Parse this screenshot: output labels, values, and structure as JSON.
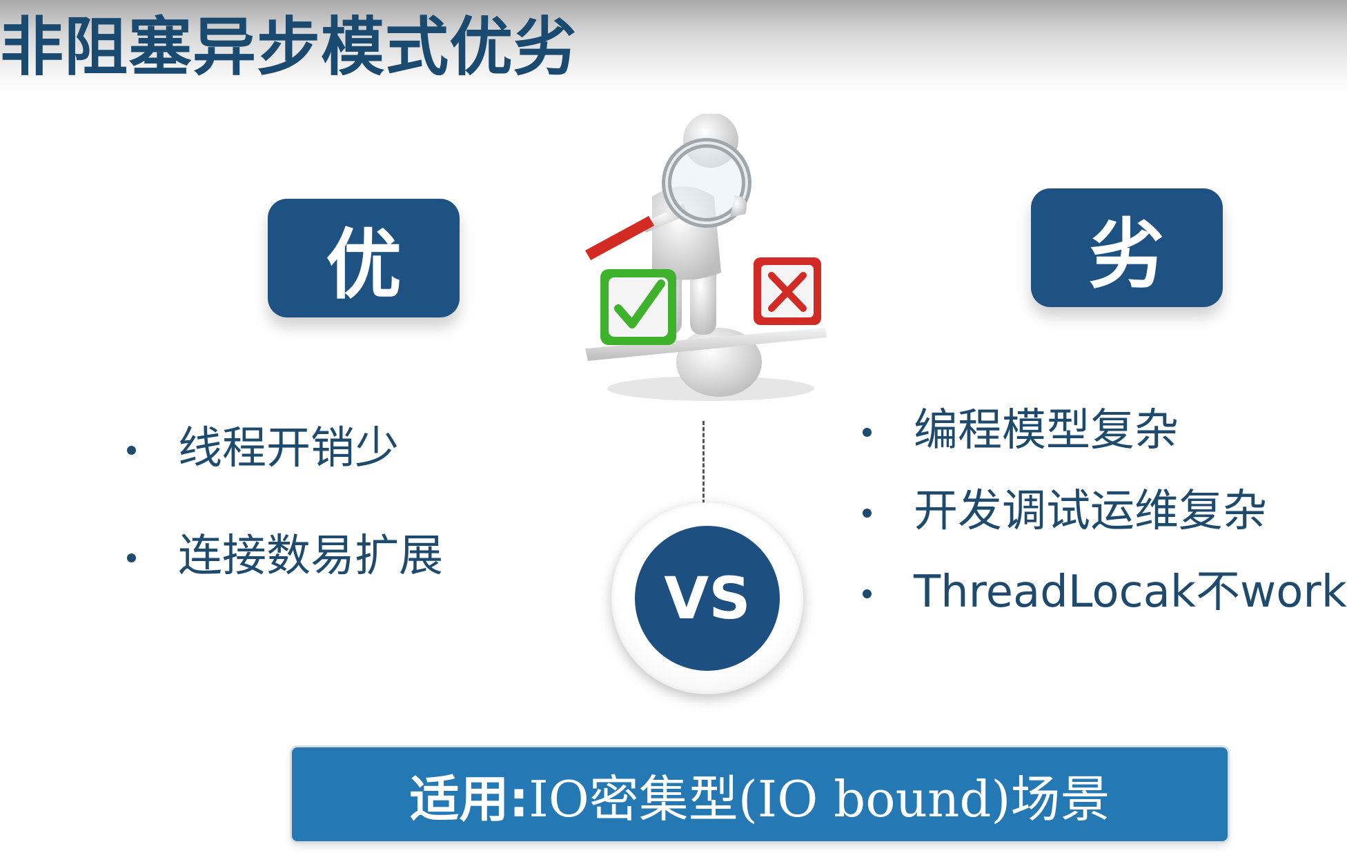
{
  "slide": {
    "title": "非阻塞异步模式优劣"
  },
  "pros": {
    "heading": "优",
    "items": [
      "线程开销少",
      "连接数易扩展"
    ]
  },
  "cons": {
    "heading": "劣",
    "items": [
      "编程模型复杂",
      "开发调试运维复杂",
      "ThreadLocak不work"
    ]
  },
  "vs": {
    "label": "VS"
  },
  "applicability": {
    "label": "适用:",
    "value": " IO密集型(IO bound)场景"
  },
  "illustration": {
    "icons": [
      "magnifier-figure-icon",
      "check-mark-icon",
      "cross-mark-icon",
      "balance-scale-icon"
    ],
    "colors": {
      "check": "#3fb22b",
      "cross": "#d22a24",
      "handle": "#d32a24"
    }
  },
  "colors": {
    "primary": "#1e5283",
    "text": "#1e4a6e",
    "banner": "#2478b4",
    "title": "#1b4a70"
  }
}
